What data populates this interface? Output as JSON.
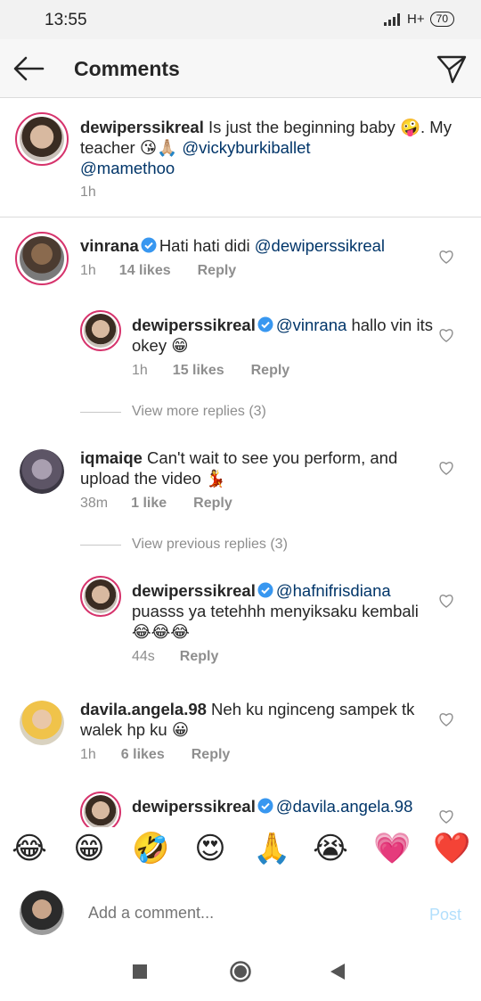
{
  "status_bar": {
    "time": "13:55",
    "network": "H+",
    "battery": "70"
  },
  "header": {
    "title": "Comments",
    "back_icon": "arrow-left-icon",
    "send_icon": "paper-plane-icon"
  },
  "caption": {
    "username": "dewiperssikreal",
    "text_part1": " Is just the beginning baby ",
    "emoji1": "🤪",
    "text_part2": ". My teacher ",
    "emoji2": "😘🙏🏼",
    "mention1": "@vickyburkiballet",
    "mention2": "@mamethoo",
    "time": "1h"
  },
  "comments": [
    {
      "username": "vinrana",
      "verified": true,
      "text": "Hati hati didi ",
      "mention": "@dewiperssikreal",
      "time": "1h",
      "likes": "14 likes",
      "reply": "Reply"
    },
    {
      "username": "dewiperssikreal",
      "verified": true,
      "mention": "@vinrana",
      "text": " hallo vin its okey ",
      "emoji": "😁",
      "time": "1h",
      "likes": "15 likes",
      "reply": "Reply"
    },
    {
      "view_replies": "View more replies (3)"
    },
    {
      "username": "iqmaiqe",
      "text": " Can't wait to see you perform, and upload the video ",
      "emoji": "💃",
      "time": "38m",
      "likes": "1 like",
      "reply": "Reply"
    },
    {
      "view_replies": "View previous replies (3)"
    },
    {
      "username": "dewiperssikreal",
      "verified": true,
      "mention": "@hafnifrisdiana",
      "text": " puasss ya tetehhh menyiksaku kembali ",
      "emoji": "😂😂😂",
      "time": "44s",
      "reply": "Reply"
    },
    {
      "username": "davila.angela.98",
      "text": " Neh ku nginceng sampek tk walek hp ku ",
      "emoji": "😀",
      "time": "1h",
      "likes": "6 likes",
      "reply": "Reply"
    },
    {
      "username": "dewiperssikreal",
      "verified": true,
      "mention": "@davila.angela.98"
    }
  ],
  "emoji_bar": [
    "😂",
    "😁",
    "🤣",
    "😍",
    "🙏",
    "😭",
    "💗",
    "❤️"
  ],
  "comment_input": {
    "placeholder": "Add a comment...",
    "post_label": "Post"
  },
  "colors": {
    "accent": "#3897f0",
    "mention": "#003569",
    "verified": "#3897f0",
    "meta": "#8e8e8e",
    "ring": "#d6336c",
    "post_disabled": "#b2dffc"
  }
}
